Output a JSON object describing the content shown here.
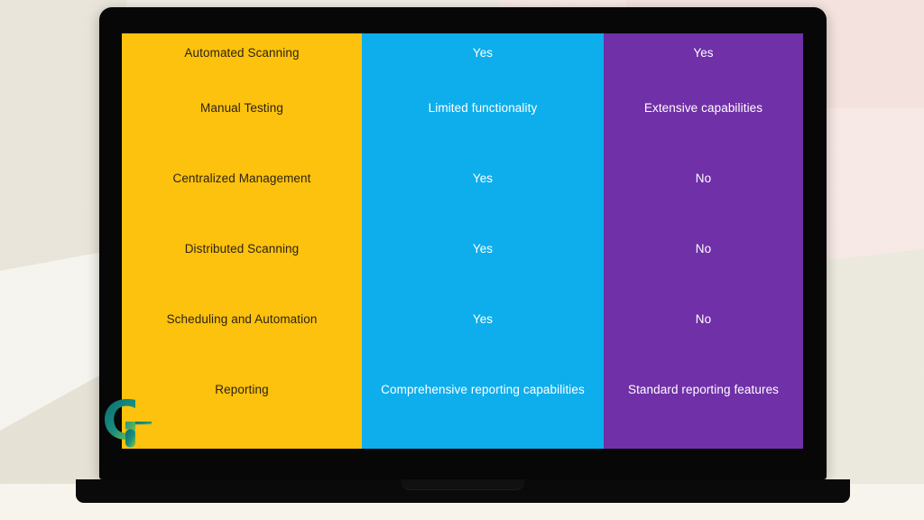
{
  "device": {
    "type": "laptop-mockup",
    "frame_color": "#070707",
    "base_color": "#0a0a0a"
  },
  "background": {
    "base_color": "#efece4",
    "accent_pink": "#f7e9e6",
    "accent_cream": "#f6f4ee"
  },
  "watermark": {
    "name": "g-logo",
    "letter": "G",
    "color_dark": "#0d6a6e",
    "color_light": "#6fbf73"
  },
  "table": {
    "colors": {
      "feature_bg": "#fcc20d",
      "feature_text": "#2e2313",
      "column_a_bg": "#0eaeec",
      "column_a_text": "#ffffff",
      "column_b_bg": "#7030a8",
      "column_b_text": "#ffffff",
      "feature_divider": "#fbe19a",
      "column_a_divider": "#8fe2fb",
      "column_b_divider": "#e2aefc"
    },
    "rows": [
      {
        "kind": "partial-top",
        "feature": "Automated Scanning",
        "column_a": "Yes",
        "column_b": "Yes"
      },
      {
        "kind": "normal",
        "feature": "Manual Testing",
        "column_a": "Limited functionality",
        "column_b": "Extensive capabilities"
      },
      {
        "kind": "normal",
        "feature": "Centralized Management",
        "column_a": "Yes",
        "column_b": "No"
      },
      {
        "kind": "normal",
        "feature": "Distributed Scanning",
        "column_a": "Yes",
        "column_b": "No"
      },
      {
        "kind": "normal",
        "feature": "Scheduling and Automation",
        "column_a": "Yes",
        "column_b": "No"
      },
      {
        "kind": "normal",
        "feature": "Reporting",
        "column_a": "Comprehensive reporting capabilities",
        "column_b": "Standard reporting features"
      },
      {
        "kind": "partial-bottom",
        "feature": "",
        "column_a": "",
        "column_b": ""
      }
    ]
  }
}
